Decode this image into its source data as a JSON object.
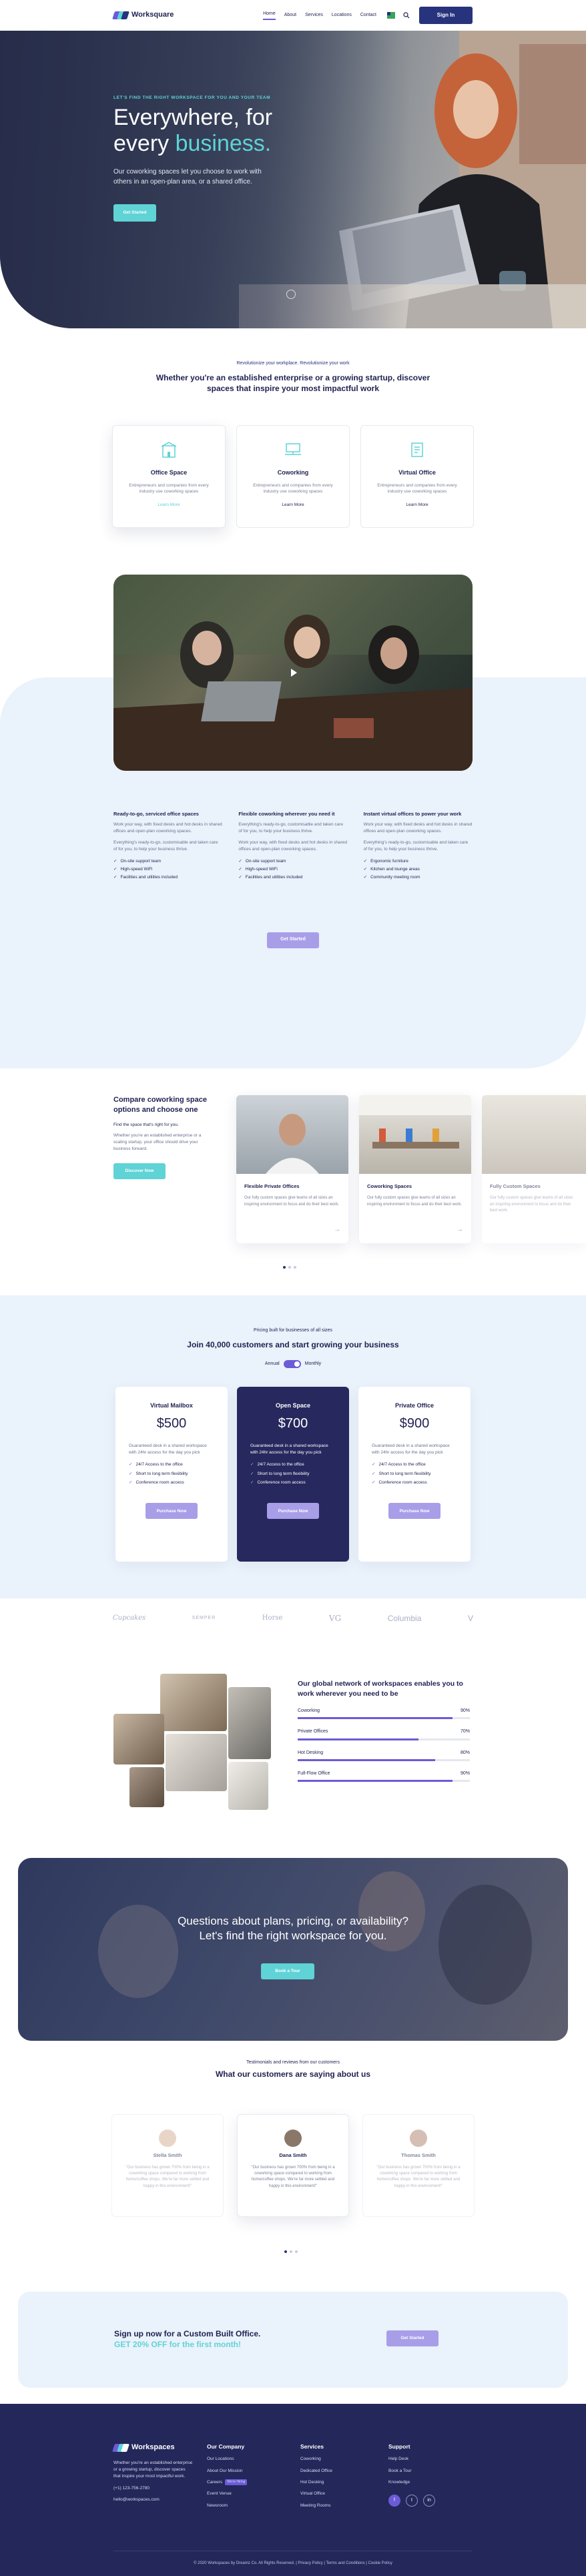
{
  "brand": {
    "name": "Worksquare",
    "footer_name": "Workspaces",
    "primary": "#27347d",
    "accent": "#5fd3d6",
    "purple": "#6b5bd6"
  },
  "nav": {
    "items": [
      "Home",
      "About",
      "Services",
      "Locations",
      "Contact"
    ],
    "signin": "Sign In"
  },
  "hero": {
    "kicker": "LET'S FIND THE RIGHT WORKSPACE FOR YOU AND YOUR TEAM",
    "title_1": "Everywhere, for",
    "title_2a": "every ",
    "title_2b": "business.",
    "subtitle": "Our coworking spaces let you choose to work with others in an open-plan area, or a shared office.",
    "cta": "Get Started"
  },
  "intro": {
    "kicker": "Revolutionize your workplace. Revolutionize your work",
    "title": "Whether you're an established enterprise or a growing startup, discover spaces that inspire your most impactful work",
    "cards": [
      {
        "title": "Office Space",
        "text": "Entrepreneurs and companies from every industry use coworking spaces",
        "link": "Learn More"
      },
      {
        "title": "Coworking",
        "text": "Entrepreneurs and companies from every industry use coworking spaces",
        "link": "Learn More"
      },
      {
        "title": "Virtual Office",
        "text": "Entrepreneurs and companies from every industry use coworking spaces",
        "link": "Learn More"
      }
    ]
  },
  "features": {
    "cols": [
      {
        "title": "Ready-to-go, serviced office spaces",
        "p1": "Work your way, with fixed desks and hot desks in shared offices and open-plan coworking spaces.",
        "p2": "Everything's ready-to-go, customisable and taken care of for you, to help your business thrive.",
        "items": [
          "On-site support team",
          "High-speed WiFi",
          "Facilities and utilities included"
        ]
      },
      {
        "title": "Flexible coworking wherever you need it",
        "p1": "Everything's ready-to-go, customisable and taken care of for you, to help your business thrive.",
        "p2": "Work your way, with fixed desks and hot desks in shared offices and open-plan coworking spaces.",
        "items": [
          "On-site support team",
          "High-speed WiFi",
          "Facilities and utilities included"
        ]
      },
      {
        "title": "Instant virtual offices to power your work",
        "p1": "Work your way, with fixed desks and hot desks in shared offices and open-plan coworking spaces.",
        "p2": "Everything's ready-to-go, customisable and taken care of for you, to help your business thrive.",
        "items": [
          "Ergonomic furniture",
          "Kitchen and lounge areas",
          "Community meeting room"
        ]
      }
    ],
    "cta": "Get Started"
  },
  "compare": {
    "title": "Compare coworking space options and choose one",
    "sub": "Find the space that's right for you.",
    "desc": "Whether you're an established enterprise or a scaling startup, your office should drive your business forward.",
    "cta": "Discover Now",
    "slides": [
      {
        "title": "Flexible Private Offices",
        "text": "Our fully custom spaces give teams of all sizes an inspiring environment to focus and do their best work."
      },
      {
        "title": "Coworking Spaces",
        "text": "Our fully custom spaces give teams of all sizes an inspiring environment to focus and do their best work."
      },
      {
        "title": "Fully Custom Spaces",
        "text": "Our fully custom spaces give teams of all sizes an inspiring environment to focus and do their best work."
      }
    ]
  },
  "pricing": {
    "kicker": "Pricing built for businesses of all sizes",
    "title": "Join 40,000 customers and start growing your business",
    "annual": "Annual",
    "monthly": "Monthly",
    "plans": [
      {
        "name": "Virtual Mailbox",
        "price": "$500",
        "desc": "Guaranteed desk in a shared workspace with 24hr access for the day you pick",
        "items": [
          "24/7 Access to the office",
          "Short to long term flexibility",
          "Conference room access"
        ],
        "cta": "Purchase Now"
      },
      {
        "name": "Open Space",
        "price": "$700",
        "desc": "Guaranteed desk in a shared workspace with 24hr access for the day you pick",
        "items": [
          "24/7 Access to the office",
          "Short to long term flexibility",
          "Conference room access"
        ],
        "cta": "Purchase Now"
      },
      {
        "name": "Private Office",
        "price": "$900",
        "desc": "Guaranteed desk in a shared workspace with 24hr access for the day you pick",
        "items": [
          "24/7 Access to the office",
          "Short to long term flexibility",
          "Conference room access"
        ],
        "cta": "Purchase Now"
      }
    ]
  },
  "logos": [
    "Cupcakes",
    "SEMPER",
    "Horse",
    "VG",
    "Columbia",
    "V"
  ],
  "network": {
    "title": "Our global network of workspaces enables you to work wherever you need to be",
    "bars": [
      {
        "label": "Coworking",
        "pct": "90%",
        "value": 0.9
      },
      {
        "label": "Private Offices",
        "pct": "70%",
        "value": 0.7
      },
      {
        "label": "Hot Desking",
        "pct": "80%",
        "value": 0.8
      },
      {
        "label": "Full-Flow Office",
        "pct": "90%",
        "value": 0.9
      }
    ]
  },
  "questions": {
    "line1": "Questions about plans, pricing, or availability?",
    "line2": "Let's find the right workspace for you.",
    "cta": "Book a Tour"
  },
  "testimonials": {
    "kicker": "Testimonials and reviews from our customers",
    "title": "What our customers are saying about us",
    "items": [
      {
        "name": "Stella Smith",
        "text": "\"Our business has grown 700% from being in a coworking space compared to working from home/coffee shops. We're far more settled and happy in this environment!\""
      },
      {
        "name": "Dana Smith",
        "text": "\"Our business has grown 700% from being in a coworking space compared to working from home/coffee shops. We're far more settled and happy in this environment!\""
      },
      {
        "name": "Thomas Smith",
        "text": "\"Our business has grown 700% from being in a coworking space compared to working from home/coffee shops. We're far more settled and happy in this environment!\""
      }
    ]
  },
  "signup": {
    "line1": "Sign up now for a Custom Built Office.",
    "line2": "GET 20% OFF for the first month!",
    "cta": "Get Started"
  },
  "footer": {
    "about": "Whether you're an established enterprise or a growing startup, discover spaces that inspire your most impactful work.",
    "phone": "(+1) 123-756-2780",
    "email": "hello@workspaces.com",
    "company": {
      "title": "Our Company",
      "items": [
        "Our Locations",
        "About Our Mission",
        "Careers",
        "Event Venue",
        "Newsroom"
      ],
      "hiring": "We're Hiring"
    },
    "services": {
      "title": "Services",
      "items": [
        "Coworking",
        "Dedicated Office",
        "Hot Desking",
        "Virtual Office",
        "Meeting Rooms"
      ]
    },
    "support": {
      "title": "Support",
      "items": [
        "Help Desk",
        "Book a Tour",
        "Knowledge"
      ]
    },
    "social": [
      "f",
      "t",
      "in"
    ],
    "copyright": "© 2020 Workspaces by Dreamz Co. All Rights Reserved. | Privacy Policy | Terms and Conditions | Cookie Policy"
  }
}
